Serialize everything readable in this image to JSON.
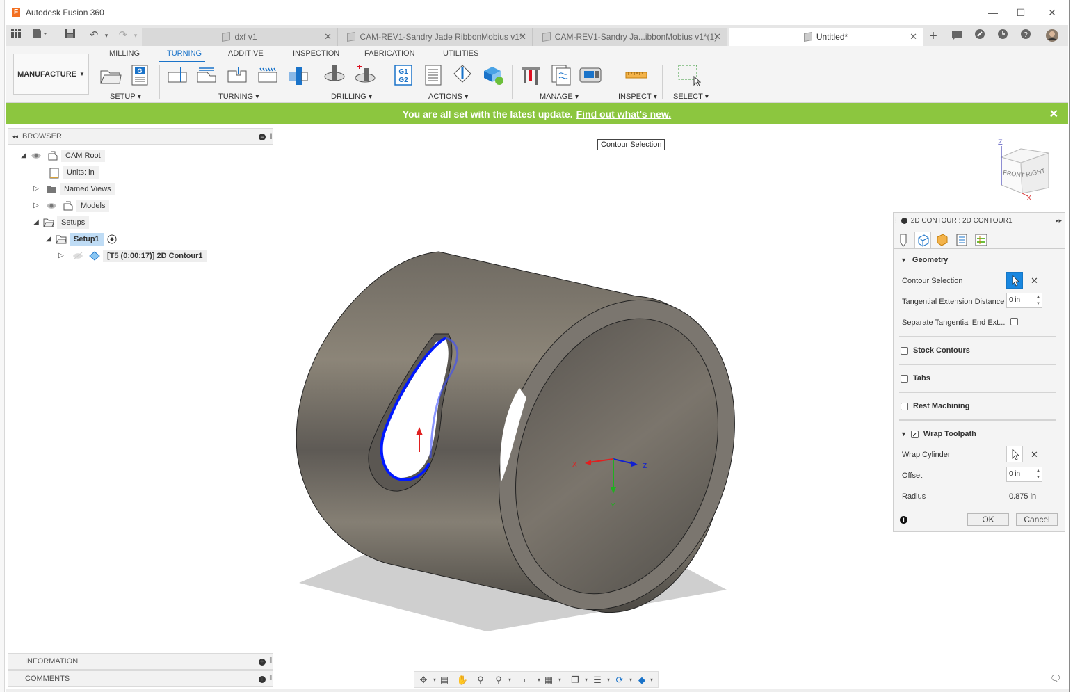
{
  "window": {
    "title": "Autodesk Fusion 360",
    "logo_letter": "F",
    "minimize": "—",
    "maximize": "☐",
    "close": "✕"
  },
  "tabs": [
    {
      "label": "dxf v1",
      "close": "✕"
    },
    {
      "label": "CAM-REV1-Sandry Jade RibbonMobius v1*",
      "close": "✕"
    },
    {
      "label": "CAM-REV1-Sandry Ja...ibbonMobius v1*(1)",
      "close": "✕"
    },
    {
      "label": "Untitled*",
      "close": "✕"
    }
  ],
  "ribbon": {
    "workspace": "MANUFACTURE",
    "tabs": [
      "MILLING",
      "TURNING",
      "ADDITIVE",
      "INSPECTION",
      "FABRICATION",
      "UTILITIES"
    ],
    "active_tab": "TURNING",
    "groups": [
      "SETUP ▾",
      "TURNING ▾",
      "DRILLING ▾",
      "ACTIONS ▾",
      "MANAGE ▾",
      "INSPECT ▾",
      "SELECT ▾"
    ],
    "g1g2_text": [
      "G1",
      "G2"
    ],
    "g_text": "G"
  },
  "notification": {
    "message": "You are all set with the latest update.",
    "link": "Find out what's new."
  },
  "browser": {
    "title": "BROWSER",
    "items": {
      "cam_root": "CAM Root",
      "units": "Units: in",
      "named_views": "Named Views",
      "models": "Models",
      "setups": "Setups",
      "setup1": "Setup1",
      "operation": "[T5 (0:00:17)] 2D Contour1"
    }
  },
  "canvas": {
    "tooltip": "Contour Selection",
    "viewcube": {
      "front": "FRONT",
      "right": "RIGHT",
      "z": "Z",
      "x": "X"
    },
    "triad": {
      "x": "X",
      "y": "Y",
      "z": "Z"
    }
  },
  "dialog": {
    "title": "2D CONTOUR : 2D CONTOUR1",
    "sections": {
      "geometry": "Geometry",
      "stock_contours": "Stock Contours",
      "tabs": "Tabs",
      "rest_machining": "Rest Machining",
      "wrap_toolpath": "Wrap Toolpath"
    },
    "fields": {
      "contour_selection": "Contour Selection",
      "tangential_extension": "Tangential Extension Distance",
      "tangential_extension_value": "0 in",
      "separate_tangential": "Separate Tangential End Ext...",
      "wrap_cylinder": "Wrap Cylinder",
      "offset": "Offset",
      "offset_value": "0 in",
      "radius": "Radius",
      "radius_value": "0.875 in"
    },
    "wrap_toolpath_checked": true,
    "ok": "OK",
    "cancel": "Cancel"
  },
  "bottom_panels": {
    "information": "INFORMATION",
    "comments": "COMMENTS"
  },
  "colors": {
    "accent": "#1a73c9",
    "notification": "#8cc63f",
    "contour": "#0018ff",
    "selection_button": "#1987e0"
  }
}
